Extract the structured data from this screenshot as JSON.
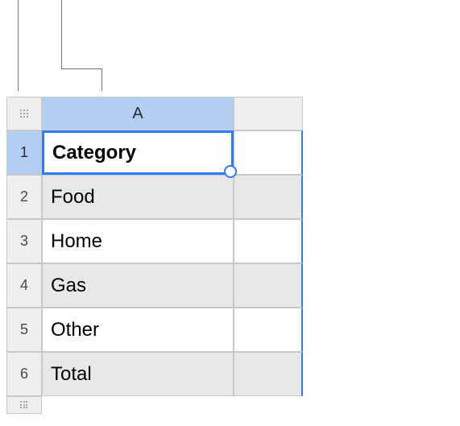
{
  "columns": {
    "A": "A"
  },
  "rows": {
    "r1": "1",
    "r2": "2",
    "r3": "3",
    "r4": "4",
    "r5": "5",
    "r6": "6"
  },
  "cells": {
    "A1": "Category",
    "A2": "Food",
    "A3": "Home",
    "A4": "Gas",
    "A5": "Other",
    "A6": "Total"
  }
}
